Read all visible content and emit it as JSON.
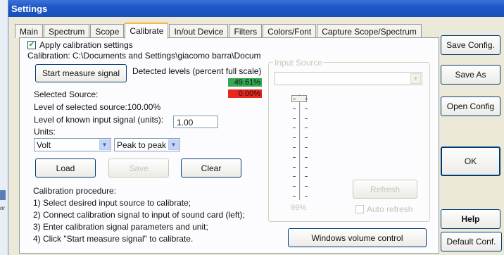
{
  "window": {
    "title": "Settings"
  },
  "tabs": [
    {
      "label": "Main"
    },
    {
      "label": "Spectrum"
    },
    {
      "label": "Scope"
    },
    {
      "label": "Calibrate"
    },
    {
      "label": "In/out Device"
    },
    {
      "label": "Filters"
    },
    {
      "label": "Colors/Font"
    },
    {
      "label": "Capture Scope/Spectrum"
    }
  ],
  "calibrate": {
    "apply_label": "Apply calibration settings",
    "apply_checked": true,
    "calibration_path": "Calibration: C:\\Documents and Settings\\giacomo barra\\Docum",
    "start_button": "Start measure signal",
    "detected_levels_label": "Detected levels (percent full scale)",
    "level1": "49.61%",
    "level1_color": "#34a853",
    "level2": "0.00%",
    "level2_color": "#e8261d",
    "selected_source_label": "Selected Source:",
    "level_selected_source": "Level of selected source:100.00%",
    "known_input_label": "Level of known input signal (units):",
    "known_input_value": "1.00",
    "units_label": "Units:",
    "unit_value": "Volt",
    "measure_value": "Peak to peak",
    "load_button": "Load",
    "save_button": "Save",
    "clear_button": "Clear",
    "procedure_title": "Calibration procedure:",
    "procedure_steps": [
      "1) Select desired input source to calibrate;",
      "2) Connect calibration signal to input of sound card (left);",
      "3) Enter calibration signal parameters and unit;",
      "4) Click \"Start measure signal\" to calibrate."
    ]
  },
  "input_source": {
    "title": "Input Source",
    "selected": "",
    "slider_percent": 99,
    "slider_label": "99%",
    "refresh_button": "Refresh",
    "auto_refresh_label": "Auto refresh",
    "auto_refresh_checked": false,
    "volume_button": "Windows volume control"
  },
  "side_buttons": {
    "save_config": "Save Config.",
    "save_as": "Save As",
    "open_config": "Open Config",
    "ok": "OK",
    "help": "Help",
    "default_conf": "Default Conf."
  },
  "desktop": {
    "fragment": "or"
  }
}
